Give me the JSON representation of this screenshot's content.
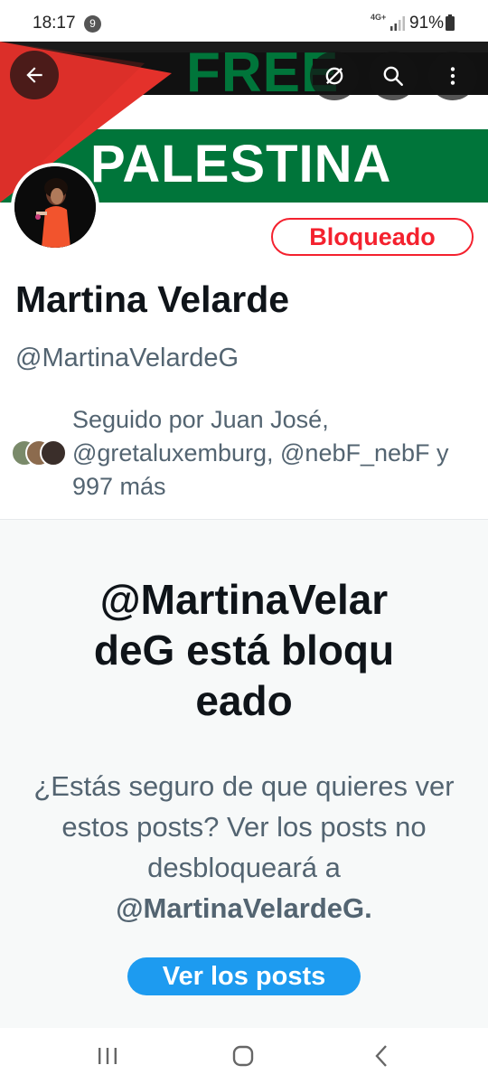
{
  "status_bar": {
    "time": "18:17",
    "notification_count": "9",
    "network": "4G+",
    "battery": "91%"
  },
  "banner": {
    "line1": "FREE",
    "line2": "PALESTINA",
    "colors": {
      "red": "#e4312b",
      "black": "#111111",
      "green": "#00753a",
      "white": "#ffffff"
    }
  },
  "toolbar": {
    "back_icon": "arrow-left-icon",
    "offline_icon": "offline-icon",
    "search_icon": "search-icon",
    "more_icon": "more-vertical-icon"
  },
  "profile": {
    "name": "Martina Velarde",
    "handle": "@MartinaVelardeG",
    "blocked_label": "Bloqueado",
    "followed_by": "Seguido por Juan José, @gretaluxemburg, @nebF_nebF y 997 más"
  },
  "blocked_notice": {
    "title": "@MartinaVelardeG está bloqueado",
    "description_pre": "¿Estás seguro de que quieres ver estos posts? Ver los posts no desbloqueará a ",
    "description_handle": "@MartinaVelardeG.",
    "button_label": "Ver los posts"
  },
  "theme": {
    "accent": "#1d9bf0",
    "danger": "#f4212e",
    "text_primary": "#0f1419",
    "text_secondary": "#536471"
  }
}
